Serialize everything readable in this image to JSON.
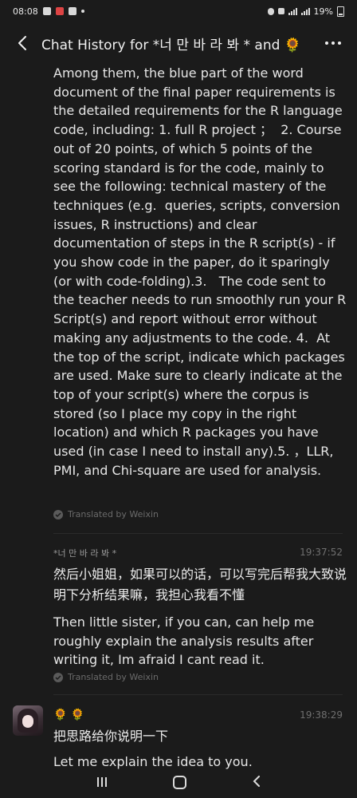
{
  "status_bar": {
    "time": "08:08",
    "battery": "19%"
  },
  "header": {
    "title": "Chat History for *너 만 바 라 봐 * and 🌻 ..."
  },
  "messages": [
    {
      "translation": "Among them, the blue part of the word document of the final paper requirements is the detailed requirements for the R language code, including: 1. full R project ；  2. Course out of 20 points, of which 5 points of the scoring standard is for the code, mainly to see the following: technical mastery of the techniques (e.g.  queries, scripts, conversion issues, R instructions) and clear documentation of steps in the R script(s) - if you show code in the paper, do it sparingly (or with code-folding).3.   The code sent to the teacher needs to run smoothly run your R Script(s) and report without error without making any adjustments to the code. 4.  At the top of the script, indicate which packages are used. Make sure to clearly indicate at the top of your script(s) where the corpus is stored (so I place my copy in the right location) and which R packages you have used (in case I need to install any).5. ，LLR, PMI, and Chi-square are used for analysis.",
      "translated_by": "Translated by Weixin"
    },
    {
      "sender": "*너 만 바 라 봐 *",
      "time": "19:37:52",
      "original": "然后小姐姐，如果可以的话，可以写完后帮我大致说明下分析结果嘛，我担心我看不懂",
      "translation": "Then little sister, if you can, can help me roughly explain the analysis results after writing it, Im afraid I cant read it.",
      "translated_by": "Translated by Weixin"
    },
    {
      "sender": "🌻 🌻",
      "time": "19:38:29",
      "original": "把思路给你说明一下",
      "translation": "Let me explain the idea to you."
    }
  ]
}
